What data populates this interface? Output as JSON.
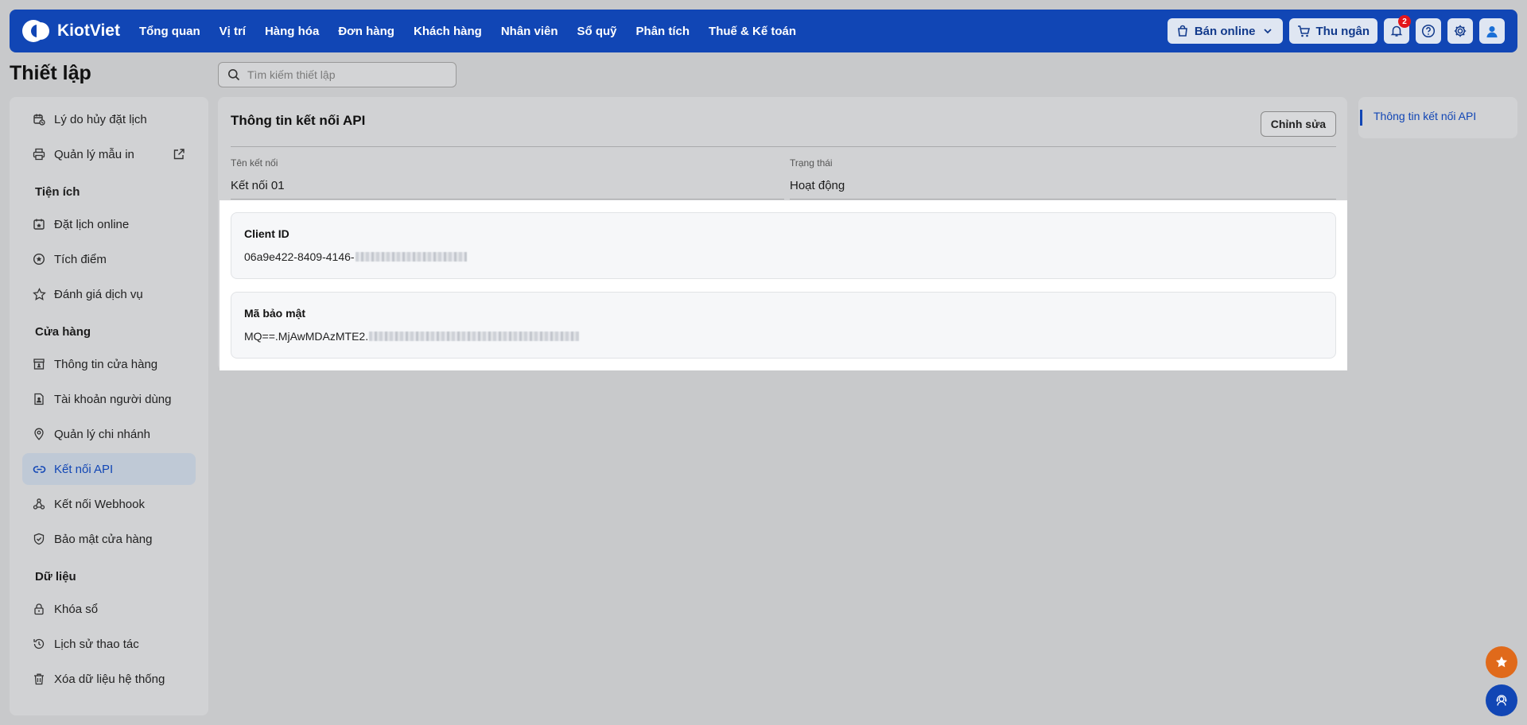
{
  "topbar": {
    "brand": "KiotViet",
    "nav": [
      "Tổng quan",
      "Vị trí",
      "Hàng hóa",
      "Đơn hàng",
      "Khách hàng",
      "Nhân viên",
      "Sổ quỹ",
      "Phân tích",
      "Thuế & Kế toán"
    ],
    "sell_online": "Bán online",
    "cashier": "Thu ngân",
    "notification_count": "2"
  },
  "page": {
    "title": "Thiết lập",
    "search_placeholder": "Tìm kiếm thiết lập"
  },
  "sidebar": {
    "top_items": [
      "Lý do hủy đặt lịch",
      "Quản lý mẫu in"
    ],
    "utilities_title": "Tiện ích",
    "utilities": [
      "Đặt lịch online",
      "Tích điểm",
      "Đánh giá dịch vụ"
    ],
    "store_title": "Cửa hàng",
    "store": [
      "Thông tin cửa hàng",
      "Tài khoản người dùng",
      "Quản lý chi nhánh",
      "Kết nối API",
      "Kết nối Webhook",
      "Bảo mật cửa hàng"
    ],
    "data_title": "Dữ liệu",
    "data": [
      "Khóa sổ",
      "Lịch sử thao tác",
      "Xóa dữ liệu hệ thống"
    ]
  },
  "main": {
    "heading": "Thông tin kết nối API",
    "edit_label": "Chỉnh sửa",
    "connection_name_label": "Tên kết nối",
    "connection_name": "Kết nối 01",
    "status_label": "Trạng thái",
    "status": "Hoạt động",
    "client_id_label": "Client ID",
    "client_id_visible": "06a9e422-8409-4146-",
    "secret_label": "Mã bảo mật",
    "secret_visible": "MQ==.MjAwMDAzMTE2."
  },
  "toc": {
    "item": "Thông tin kết nối API"
  },
  "colors": {
    "brand": "#1146b5",
    "accent_orange": "#e06a1b"
  }
}
